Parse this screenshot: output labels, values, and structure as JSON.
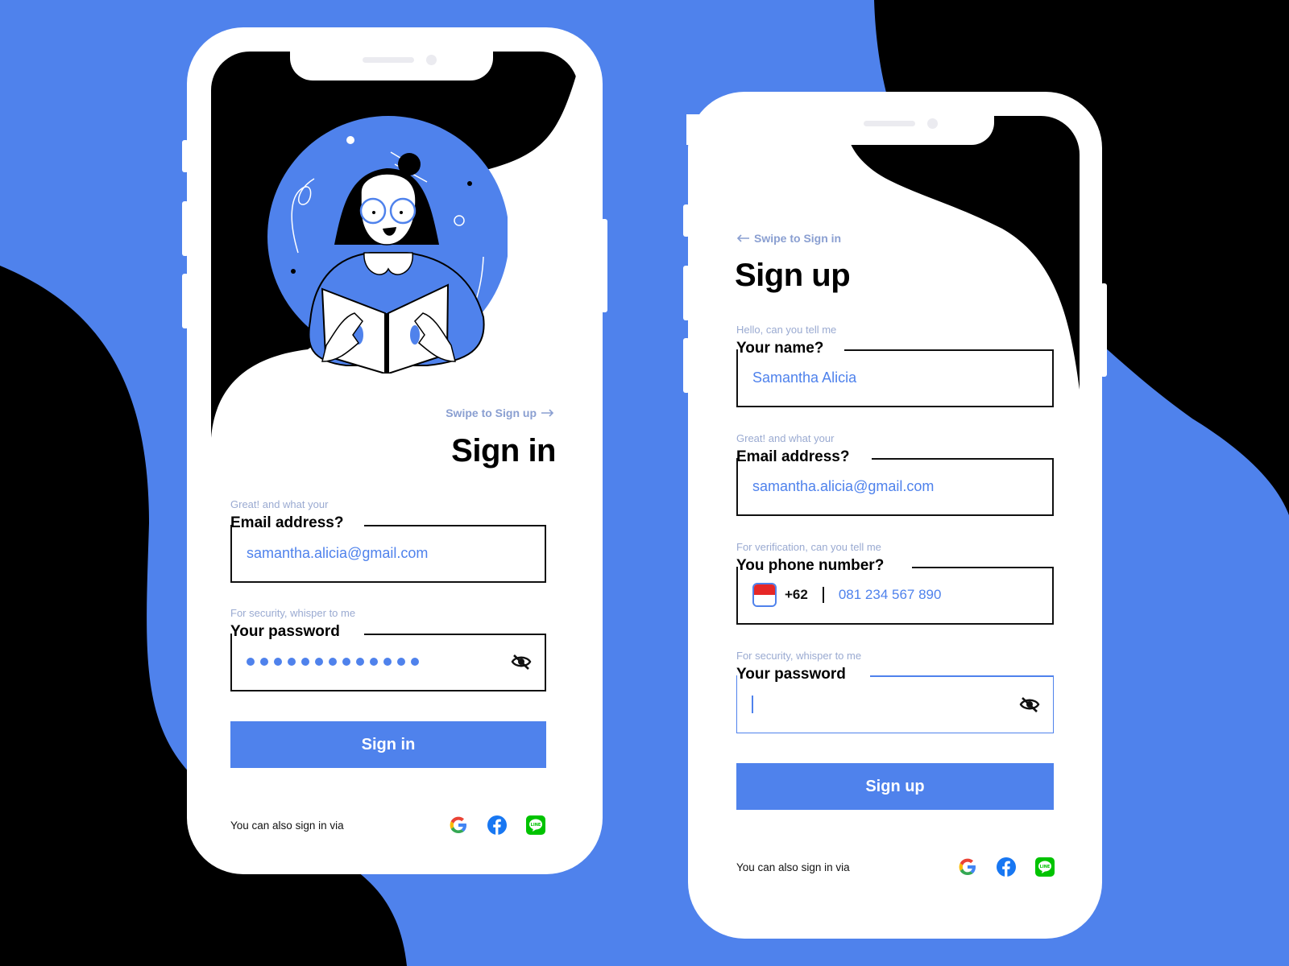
{
  "colors": {
    "accent": "#4f82ec",
    "hint": "#9aaad1",
    "swipe": "#8a9fd1",
    "dark": "#000000"
  },
  "signin": {
    "swipe_label": "Swipe to Sign up",
    "swipe_icon": "arrow-right-icon",
    "title": "Sign in",
    "email": {
      "hint": "Great! and what your",
      "label": "Email address?",
      "value": "samantha.alicia@gmail.com"
    },
    "password": {
      "hint": "For security, whisper to me",
      "label": "Your password",
      "masked_length": 13,
      "toggle_icon": "eye-off-icon"
    },
    "submit_label": "Sign in",
    "also_label": "You can also sign in via",
    "social": [
      "google-icon",
      "facebook-icon",
      "line-icon"
    ]
  },
  "signup": {
    "swipe_label": "Swipe to Sign in",
    "swipe_icon": "arrow-left-icon",
    "title": "Sign up",
    "name": {
      "hint": "Hello, can you tell me",
      "label": "Your name?",
      "value": "Samantha Alicia"
    },
    "email": {
      "hint": "Great! and what your",
      "label": "Email address?",
      "value": "samantha.alicia@gmail.com"
    },
    "phone": {
      "hint": "For verification, can you tell me",
      "label": "You phone number?",
      "country_flag": "indonesia-flag-icon",
      "dial_code": "+62",
      "value": "081 234 567 890"
    },
    "password": {
      "hint": "For security, whisper to me",
      "label": "Your password",
      "value": "",
      "toggle_icon": "eye-off-icon"
    },
    "submit_label": "Sign up",
    "also_label": "You can also sign in via",
    "social": [
      "google-icon",
      "facebook-icon",
      "line-icon"
    ]
  }
}
